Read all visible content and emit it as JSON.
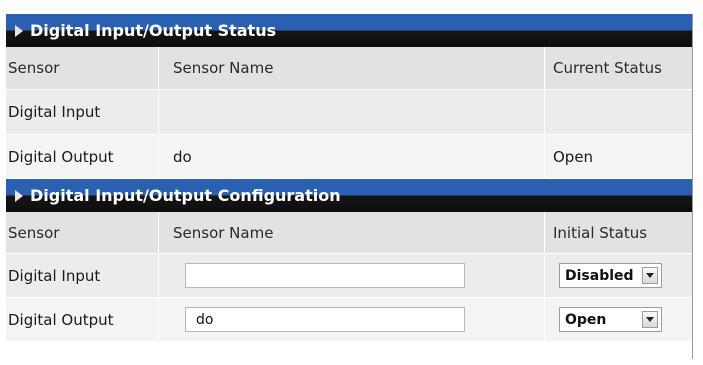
{
  "status_section": {
    "title": "Digital Input/Output Status",
    "headers": [
      "Sensor",
      "Sensor Name",
      "Current Status"
    ],
    "rows": [
      {
        "sensor": "Digital Input",
        "name": "",
        "status": ""
      },
      {
        "sensor": "Digital Output",
        "name": "do",
        "status": "Open"
      }
    ]
  },
  "config_section": {
    "title": "Digital Input/Output Configuration",
    "headers": [
      "Sensor",
      "Sensor Name",
      "Initial Status"
    ],
    "rows": [
      {
        "sensor": "Digital Input",
        "name_value": "",
        "initial_status": "Disabled"
      },
      {
        "sensor": "Digital Output",
        "name_value": "do",
        "initial_status": "Open"
      }
    ]
  },
  "icons": {
    "section_expander": "triangle-right-icon",
    "select_arrow": "chevron-down-icon"
  },
  "colors": {
    "header_top": "#2b5fb0",
    "header_bottom": "#0e0e0e",
    "row_header_bg": "#e2e2e2",
    "row_odd_bg": "#ececec",
    "row_even_bg": "#f4f4f4"
  }
}
